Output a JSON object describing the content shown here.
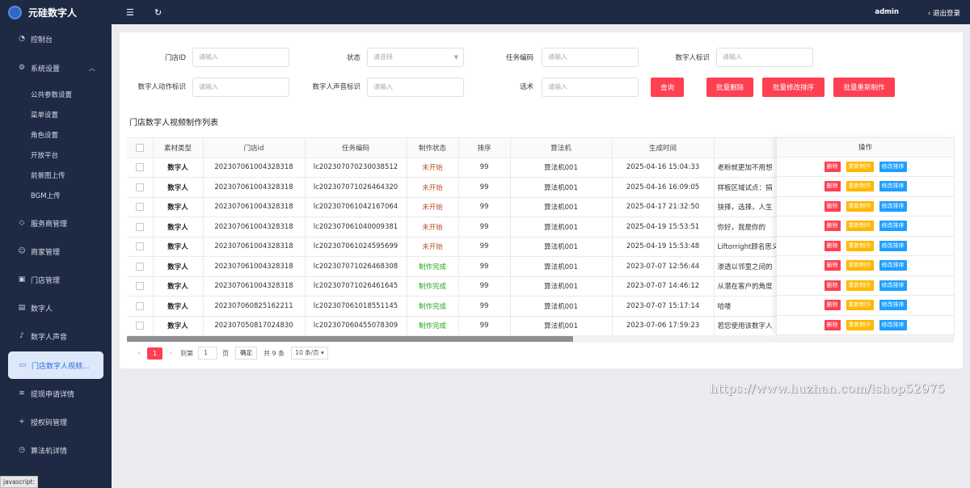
{
  "app": {
    "title": "元硅数字人"
  },
  "sidebar": {
    "items": [
      {
        "label": "控制台",
        "icon": "dashboard-icon"
      },
      {
        "label": "系统设置",
        "icon": "settings-icon"
      },
      {
        "label": "公共参数设置"
      },
      {
        "label": "菜单设置"
      },
      {
        "label": "角色设置"
      },
      {
        "label": "开放平台"
      },
      {
        "label": "前景图上传"
      },
      {
        "label": "BGM上传"
      },
      {
        "label": "服务商管理",
        "icon": "diamond-icon"
      },
      {
        "label": "商家管理",
        "icon": "smile-icon"
      },
      {
        "label": "门店管理",
        "icon": "store-icon"
      },
      {
        "label": "数字人",
        "icon": "user-card-icon"
      },
      {
        "label": "数字人声音",
        "icon": "music-icon"
      },
      {
        "label": "门店数字人视频...",
        "icon": "video-icon"
      },
      {
        "label": "提现申请详情",
        "icon": "layers-icon"
      },
      {
        "label": "授权码管理",
        "icon": "plus-icon"
      },
      {
        "label": "算法机详情",
        "icon": "clock-icon"
      }
    ],
    "status_tip": "javascript:"
  },
  "topbar": {
    "user": "admin",
    "logout": "退出登录"
  },
  "filters": {
    "store_id_label": "门店ID",
    "store_id_placeholder": "请输入",
    "status_label": "状态",
    "status_placeholder": "请选择",
    "task_code_label": "任务编码",
    "task_code_placeholder": "请输入",
    "dh_id_label": "数字人标识",
    "dh_id_placeholder": "请输入",
    "dh_action_label": "数字人动作标识",
    "dh_action_placeholder": "请输入",
    "dh_voice_label": "数字人声音标识",
    "dh_voice_placeholder": "请输入",
    "script_label": "话术",
    "script_placeholder": "请输入"
  },
  "buttons": {
    "query": "查询",
    "batch_delete": "批量删除",
    "batch_sort": "批量修改排序",
    "batch_remake": "批量重新制作"
  },
  "list": {
    "title": "门店数字人视频制作列表",
    "columns": [
      "素材类型",
      "门店id",
      "任务编码",
      "制作状态",
      "排序",
      "算法机",
      "生成时间",
      "",
      "操作"
    ],
    "rows": [
      {
        "type": "数字人",
        "store_id": "202307061004328318",
        "task_code": "lc202307070230038512",
        "status": "未开始",
        "status_kind": "wait",
        "sort": "99",
        "machine": "算法机001",
        "time": "2025-04-16 15:04:33",
        "script": "老粉就更加不用想"
      },
      {
        "type": "数字人",
        "store_id": "202307061004328318",
        "task_code": "lc202307071026464320",
        "status": "未开始",
        "status_kind": "wait",
        "sort": "99",
        "machine": "算法机001",
        "time": "2025-04-16 16:09:05",
        "script": "样板区域试点：捐"
      },
      {
        "type": "数字人",
        "store_id": "202307061004328318",
        "task_code": "lc202307061042167064",
        "status": "未开始",
        "status_kind": "wait",
        "sort": "99",
        "machine": "算法机001",
        "time": "2025-04-17 21:32:50",
        "script": "抉择，选择，人生"
      },
      {
        "type": "数字人",
        "store_id": "202307061004328318",
        "task_code": "lc202307061040009381",
        "status": "未开始",
        "status_kind": "wait",
        "sort": "99",
        "machine": "算法机001",
        "time": "2025-04-19 15:53:51",
        "script": "你好，我是你的"
      },
      {
        "type": "数字人",
        "store_id": "202307061004328318",
        "task_code": "lc202307061024595699",
        "status": "未开始",
        "status_kind": "wait",
        "sort": "99",
        "machine": "算法机001",
        "time": "2025-04-19 15:53:48",
        "script": "Liftorright顾名思义"
      },
      {
        "type": "数字人",
        "store_id": "202307061004328318",
        "task_code": "lc202307071026468308",
        "status": "制作完成",
        "status_kind": "done",
        "sort": "99",
        "machine": "算法机001",
        "time": "2023-07-07 12:56:44",
        "script": "渗透以邻里之间的"
      },
      {
        "type": "数字人",
        "store_id": "202307061004328318",
        "task_code": "lc202307071026461645",
        "status": "制作完成",
        "status_kind": "done",
        "sort": "99",
        "machine": "算法机001",
        "time": "2023-07-07 14:46:12",
        "script": "从潜在客户的角度"
      },
      {
        "type": "数字人",
        "store_id": "202307060825162211",
        "task_code": "lc202307061018551145",
        "status": "制作完成",
        "status_kind": "done",
        "sort": "99",
        "machine": "算法机001",
        "time": "2023-07-07 15:17:14",
        "script": "哈喽"
      },
      {
        "type": "数字人",
        "store_id": "202307050817024830",
        "task_code": "lc202307060455078309",
        "status": "制作完成",
        "status_kind": "done",
        "sort": "99",
        "machine": "算法机001",
        "time": "2023-07-06 17:59:23",
        "script": "若您使用该数字人"
      }
    ],
    "row_actions": {
      "delete": "删除",
      "remake": "重新制作",
      "sort": "修改排序"
    },
    "scroll_fraction": 0.54
  },
  "pagination": {
    "current": "1",
    "goto_label": "到第",
    "goto_value": "1",
    "page_unit": "页",
    "confirm": "确定",
    "total": "共 9 条",
    "page_size": "10 条/页"
  },
  "watermark": "https://www.huzhan.com/ishop52975",
  "colors": {
    "sidebar_bg": "#1e2a44",
    "accent_red": "#ff3f52",
    "accent_orange": "#ffb800",
    "accent_blue": "#1e9fff",
    "status_wait": "#b7542a",
    "status_done": "#2aa51e"
  }
}
